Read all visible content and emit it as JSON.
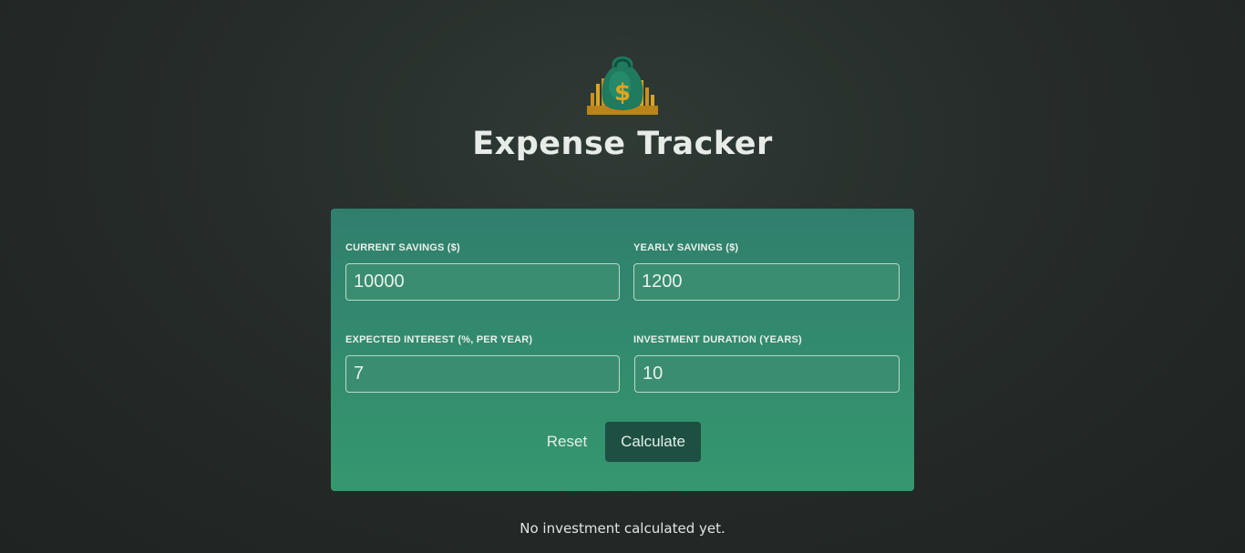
{
  "app": {
    "title": "Expense Tracker",
    "logo_icon": "money-bag-icon"
  },
  "form": {
    "current_savings": {
      "label": "Current Savings ($)",
      "value": "10000"
    },
    "yearly_savings": {
      "label": "Yearly Savings ($)",
      "value": "1200"
    },
    "expected_interest": {
      "label": "Expected Interest (%, per year)",
      "value": "7"
    },
    "investment_duration": {
      "label": "Investment Duration (years)",
      "value": "10"
    },
    "reset_label": "Reset",
    "calculate_label": "Calculate"
  },
  "status": {
    "message": "No investment calculated yet."
  },
  "colors": {
    "card_top": "#307f6d",
    "card_bottom": "#35976f",
    "button_dark": "#1d4f42",
    "logo_gold": "#e2a41f"
  }
}
